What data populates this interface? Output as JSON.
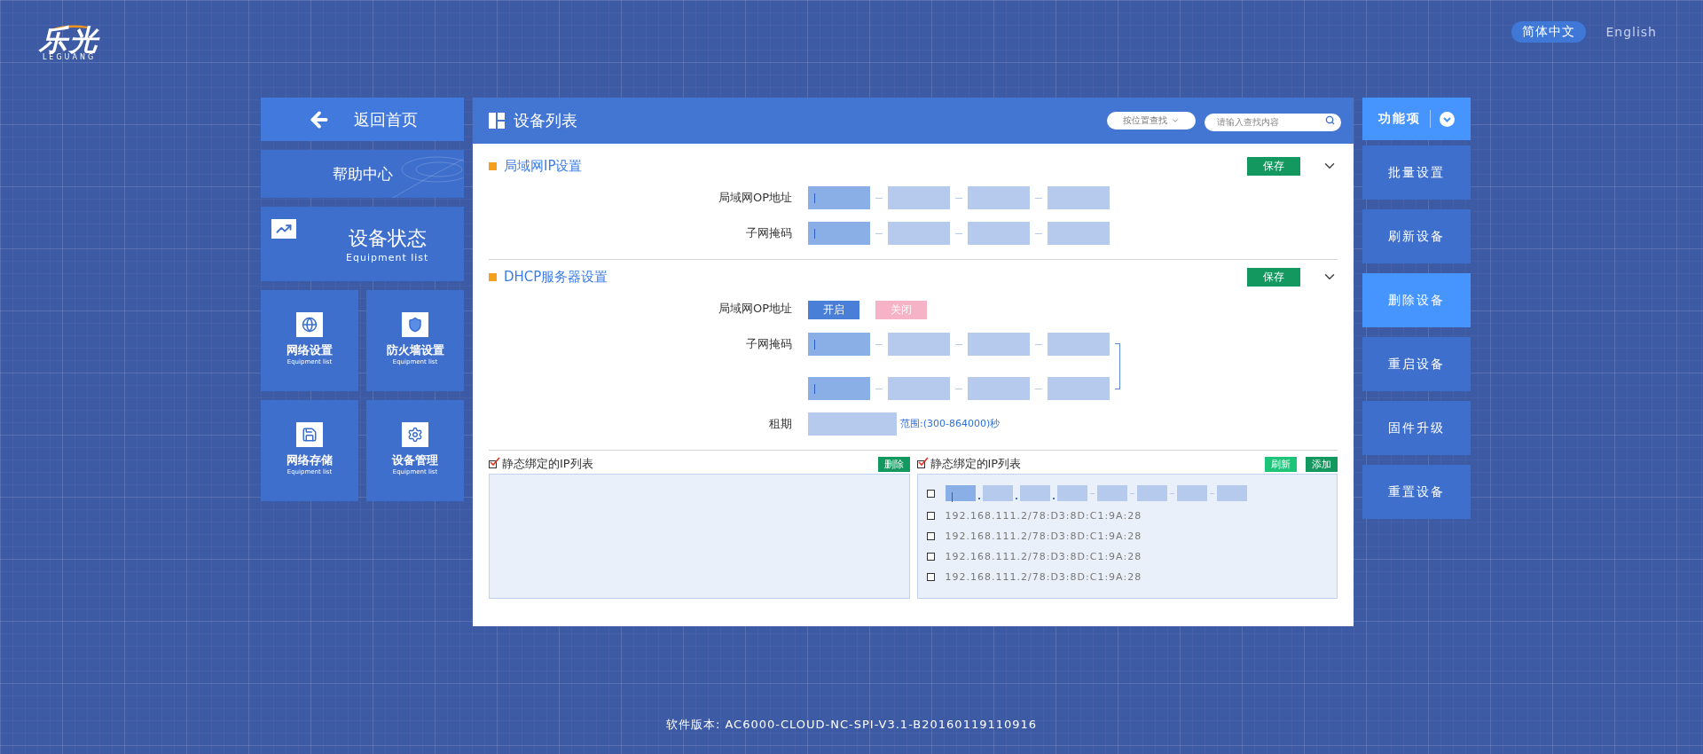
{
  "logo": {
    "name": "乐光",
    "subtitle": "LEGUANG"
  },
  "languages": [
    {
      "label": "简体中文",
      "selected": true
    },
    {
      "label": "English",
      "selected": false
    }
  ],
  "nav": {
    "back": "返回首页",
    "help": "帮助中心",
    "status": {
      "title": "设备状态",
      "subtitle": "Equipment list"
    },
    "tiles": [
      {
        "kind": "globe",
        "title": "网络设置",
        "subtitle": "Equipment list"
      },
      {
        "kind": "shield",
        "title": "防火墙设置",
        "subtitle": "Equipment list"
      },
      {
        "kind": "disk",
        "title": "网络存储",
        "subtitle": "Equipment list"
      },
      {
        "kind": "gear",
        "title": "设备管理",
        "subtitle": "Equipment list"
      }
    ]
  },
  "panel": {
    "title": "设备列表",
    "location_select": {
      "value": "按位置查找"
    },
    "search": {
      "placeholder": "请输入查找内容"
    },
    "sections": [
      {
        "title": "局域网IP设置",
        "save": "保存",
        "rows": [
          {
            "kind": "ip",
            "label": "局域网OP地址",
            "cursor": true
          },
          {
            "kind": "ip",
            "label": "子网掩码",
            "cursor": true
          }
        ]
      },
      {
        "title": "DHCP服务器设置",
        "save": "保存",
        "rows": [
          {
            "kind": "toggle",
            "label": "局域网OP地址",
            "options": [
              {
                "label": "开启",
                "selected": true
              },
              {
                "label": "关闭",
                "selected": false
              }
            ]
          },
          {
            "kind": "ip_pair",
            "label": "子网掩码",
            "cursor": true
          },
          {
            "kind": "lease",
            "label": "租期",
            "hint": "范围:(300-864000)秒"
          }
        ]
      }
    ],
    "lists": [
      {
        "title": "静态绑定的IP列表",
        "checked": true,
        "buttons": [
          {
            "label": "删除",
            "kind": "dark"
          }
        ]
      },
      {
        "title": "静态绑定的IP列表",
        "checked": true,
        "buttons": [
          {
            "label": "刷新",
            "kind": "light"
          },
          {
            "label": "添加",
            "kind": "dark"
          }
        ],
        "editor": {
          "checked": false,
          "cursor": true
        },
        "entries": [
          {
            "text": "192.168.111.2/78:D3:8D:C1:9A:28",
            "checked": false
          },
          {
            "text": "192.168.111.2/78:D3:8D:C1:9A:28",
            "checked": false
          },
          {
            "text": "192.168.111.2/78:D3:8D:C1:9A:28",
            "checked": false
          },
          {
            "text": "192.168.111.2/78:D3:8D:C1:9A:28",
            "checked": false
          }
        ]
      }
    ]
  },
  "functions": {
    "title": "功能项",
    "items": [
      {
        "label": "批量设置",
        "selected": false
      },
      {
        "label": "刷新设备",
        "selected": false
      },
      {
        "label": "删除设备",
        "selected": true
      },
      {
        "label": "重启设备",
        "selected": false
      },
      {
        "label": "固件升级",
        "selected": false
      },
      {
        "label": "重置设备",
        "selected": false
      }
    ]
  },
  "footer": "软件版本: AC6000-CLOUD-NC-SPI-V3.1-B20160119110916"
}
